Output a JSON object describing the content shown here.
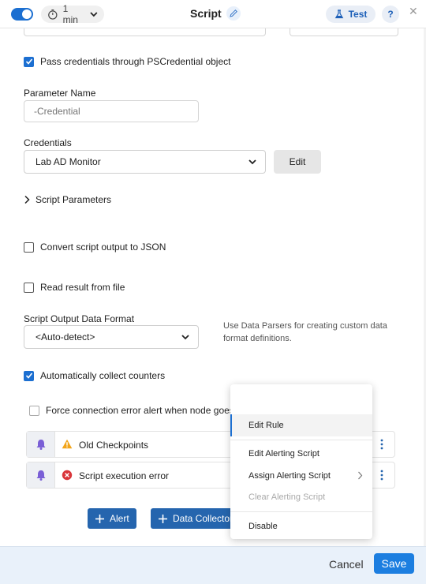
{
  "header": {
    "interval_value": "1 min",
    "title": "Script",
    "test_label": "Test",
    "help_label": "?",
    "close_label": "✕"
  },
  "form": {
    "pass_credentials_label": "Pass credentials through PSCredential object",
    "pass_credentials_checked": true,
    "parameter_name_label": "Parameter Name",
    "parameter_name_placeholder": "-Credential",
    "credentials_label": "Credentials",
    "credentials_value": "Lab AD Monitor",
    "credentials_edit_label": "Edit",
    "script_parameters_label": "Script Parameters",
    "convert_json_label": "Convert script output to JSON",
    "convert_json_checked": false,
    "read_file_label": "Read result from file",
    "read_file_checked": false,
    "output_format_label": "Script Output Data Format",
    "output_format_value": "<Auto-detect>",
    "output_format_hint": "Use Data Parsers for creating custom data format definitions.",
    "auto_collect_label": "Automatically collect counters",
    "auto_collect_checked": true,
    "force_error_label": "Force connection error alert when node goes to down state",
    "force_error_checked": false
  },
  "alerts": [
    {
      "name": "Old Checkpoints",
      "severity": "warning"
    },
    {
      "name": "Script execution error",
      "severity": "error"
    }
  ],
  "actions": {
    "alert_label": "Alert",
    "data_collector_label": "Data Collector"
  },
  "context_menu": {
    "items": [
      {
        "label": "Edit Rule",
        "active": true
      },
      {
        "label": "Edit Alerting Script"
      },
      {
        "label": "Assign Alerting Script",
        "has_submenu": true
      },
      {
        "label": "Clear Alerting Script",
        "disabled": true
      },
      {
        "label": "Disable"
      }
    ]
  },
  "footer": {
    "cancel_label": "Cancel",
    "save_label": "Save"
  },
  "colors": {
    "accent": "#1c6fd1",
    "button_blue": "#2565ae",
    "warning": "#f2a51a",
    "error": "#d9353a",
    "bell": "#7a5fd6",
    "footer_bg": "#e9f1fa"
  }
}
